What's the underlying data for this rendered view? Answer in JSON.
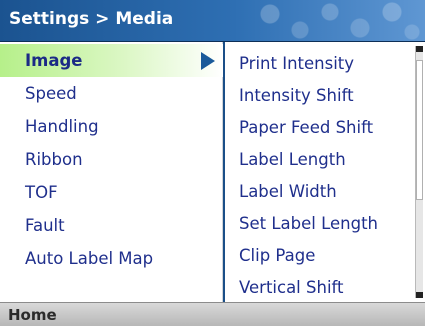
{
  "header": {
    "title": "Settings > Media"
  },
  "left_menu": {
    "items": [
      {
        "label": "Image"
      },
      {
        "label": "Speed"
      },
      {
        "label": "Handling"
      },
      {
        "label": "Ribbon"
      },
      {
        "label": "TOF"
      },
      {
        "label": "Fault"
      },
      {
        "label": "Auto Label Map"
      }
    ],
    "selected_label": "Image",
    "expand_icon": "triangle-right-icon"
  },
  "right_menu": {
    "items": [
      {
        "label": "Print Intensity"
      },
      {
        "label": "Intensity Shift"
      },
      {
        "label": "Paper Feed Shift"
      },
      {
        "label": "Label Length"
      },
      {
        "label": "Label Width"
      },
      {
        "label": "Set Label Length"
      },
      {
        "label": "Clip Page"
      },
      {
        "label": "Vertical Shift"
      }
    ]
  },
  "footer": {
    "home_label": "Home"
  },
  "colors": {
    "title_bar": "#2e6fb3",
    "selected_item": "#b6f08a",
    "menu_text": "#1f2f8c",
    "footer": "#c8c8c8"
  }
}
